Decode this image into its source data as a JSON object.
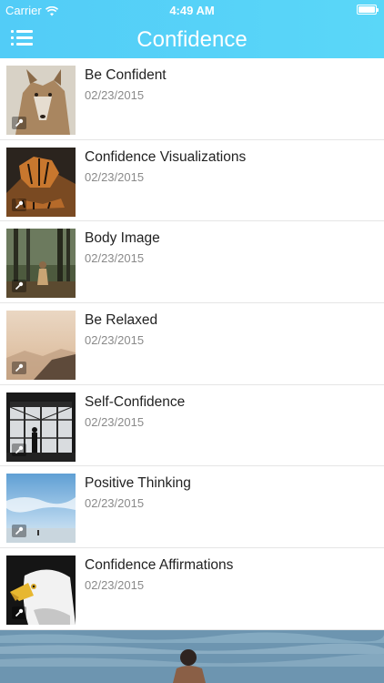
{
  "status_bar": {
    "carrier": "Carrier",
    "time": "4:49 AM",
    "icons": [
      "wifi-icon",
      "battery-icon"
    ]
  },
  "nav": {
    "title": "Confidence",
    "menu_icon": "list-menu-icon"
  },
  "colors": {
    "header": "#52ccf7",
    "title_text": "#222222",
    "date_text": "#8a8a8a",
    "divider": "#e5e5e5"
  },
  "items": [
    {
      "title": "Be Confident",
      "date": "02/23/2015",
      "thumbnail": "coyote-photo"
    },
    {
      "title": "Confidence Visualizations",
      "date": "02/23/2015",
      "thumbnail": "tiger-photo"
    },
    {
      "title": "Body Image",
      "date": "02/23/2015",
      "thumbnail": "forest-person-photo"
    },
    {
      "title": "Be Relaxed",
      "date": "02/23/2015",
      "thumbnail": "misty-hills-photo"
    },
    {
      "title": "Self-Confidence",
      "date": "02/23/2015",
      "thumbnail": "silhouette-window-photo"
    },
    {
      "title": "Positive Thinking",
      "date": "02/23/2015",
      "thumbnail": "sky-beach-photo"
    },
    {
      "title": "Confidence Affirmations",
      "date": "02/23/2015",
      "thumbnail": "eagle-photo"
    }
  ],
  "bottom_banner": {
    "image": "beach-person-photo"
  }
}
